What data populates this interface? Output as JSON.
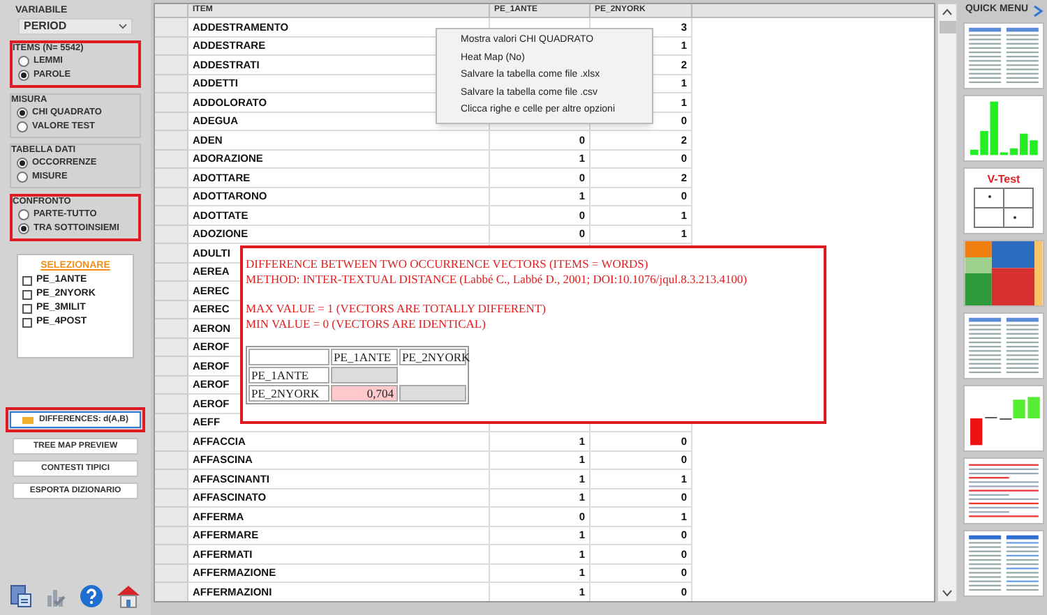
{
  "sidebar": {
    "variable": {
      "label": "VARIABILE",
      "value": "PERIOD"
    },
    "groups": [
      {
        "title": "ITEMS (N= 5542)",
        "highlighted": true,
        "options": [
          {
            "label": "LEMMI",
            "selected": false
          },
          {
            "label": "PAROLE",
            "selected": true
          }
        ]
      },
      {
        "title": "MISURA",
        "highlighted": false,
        "options": [
          {
            "label": "CHI QUADRATO",
            "selected": true
          },
          {
            "label": "VALORE TEST",
            "selected": false
          }
        ]
      },
      {
        "title": "TABELLA DATI",
        "highlighted": false,
        "options": [
          {
            "label": "OCCORRENZE",
            "selected": true
          },
          {
            "label": "MISURE",
            "selected": false
          }
        ]
      },
      {
        "title": "CONFRONTO",
        "highlighted": true,
        "options": [
          {
            "label": "PARTE-TUTTO",
            "selected": false
          },
          {
            "label": "TRA SOTTOINSIEMI",
            "selected": true
          }
        ]
      }
    ],
    "select_link": "SELEZIONARE",
    "subsets": [
      {
        "label": "PE_1ANTE",
        "checked": false
      },
      {
        "label": "PE_2NYORK",
        "checked": false
      },
      {
        "label": "PE_3MILIT",
        "checked": false
      },
      {
        "label": "PE_4POST",
        "checked": false
      }
    ],
    "buttons": [
      {
        "label": "DIFFERENCES: d(A,B)",
        "kind": "icon",
        "highlighted": true
      },
      {
        "label": "TREE MAP PREVIEW",
        "kind": "plain",
        "highlighted": false
      },
      {
        "label": "CONTESTI TIPICI",
        "kind": "plain",
        "highlighted": false
      },
      {
        "label": "ESPORTA DIZIONARIO",
        "kind": "plain",
        "highlighted": false
      }
    ],
    "tools": [
      {
        "kind": "export"
      },
      {
        "kind": "chart"
      },
      {
        "kind": "help"
      },
      {
        "kind": "home"
      }
    ]
  },
  "table": {
    "columns": [
      "ITEM",
      "PE_1ANTE",
      "PE_2NYORK"
    ],
    "rows": [
      {
        "item": "ADDESTRAMENTO",
        "pe_2nyork": "3"
      },
      {
        "item": "ADDESTRARE",
        "pe_2nyork": "1"
      },
      {
        "item": "ADDESTRATI",
        "pe_2nyork": "2"
      },
      {
        "item": "ADDETTI",
        "pe_2nyork": "1"
      },
      {
        "item": "ADDOLORATO",
        "pe_2nyork": "1"
      },
      {
        "item": "ADEGUA",
        "pe_2nyork": "0"
      },
      {
        "item": "ADEN",
        "pe_1ante": "0",
        "pe_2nyork": "2"
      },
      {
        "item": "ADORAZIONE",
        "pe_1ante": "1",
        "pe_2nyork": "0"
      },
      {
        "item": "ADOTTARE",
        "pe_1ante": "0",
        "pe_2nyork": "2"
      },
      {
        "item": "ADOTTARONO",
        "pe_1ante": "1",
        "pe_2nyork": "0"
      },
      {
        "item": "ADOTTATE",
        "pe_1ante": "0",
        "pe_2nyork": "1"
      },
      {
        "item": "ADOZIONE",
        "pe_1ante": "0",
        "pe_2nyork": "1"
      },
      {
        "item": "ADULTI"
      },
      {
        "item": "AEREA"
      },
      {
        "item": "AEREC"
      },
      {
        "item": "AEREC"
      },
      {
        "item": "AERON"
      },
      {
        "item": "AEROF"
      },
      {
        "item": "AEROF"
      },
      {
        "item": "AEROF"
      },
      {
        "item": "AEROF"
      },
      {
        "item": "AEFF"
      },
      {
        "item": "AFFACCIA",
        "pe_1ante": "1",
        "pe_2nyork": "0"
      },
      {
        "item": "AFFASCINA",
        "pe_1ante": "1",
        "pe_2nyork": "0"
      },
      {
        "item": "AFFASCINANTI",
        "pe_1ante": "1",
        "pe_2nyork": "1"
      },
      {
        "item": "AFFASCINATO",
        "pe_1ante": "1",
        "pe_2nyork": "0"
      },
      {
        "item": "AFFERMA",
        "pe_1ante": "0",
        "pe_2nyork": "1"
      },
      {
        "item": "AFFERMARE",
        "pe_1ante": "1",
        "pe_2nyork": "0"
      },
      {
        "item": "AFFERMATI",
        "pe_1ante": "1",
        "pe_2nyork": "0"
      },
      {
        "item": "AFFERMAZIONE",
        "pe_1ante": "1",
        "pe_2nyork": "0"
      },
      {
        "item": "AFFERMAZIONI",
        "pe_1ante": "1",
        "pe_2nyork": "0"
      }
    ]
  },
  "context_menu": {
    "items": [
      "Mostra valori CHI QUADRATO",
      "Heat Map (No)",
      "Salvare la tabella come file .xlsx",
      "Salvare la tabella come file .csv",
      "Clicca righe e celle per altre opzioni"
    ]
  },
  "popup": {
    "paragraphs": [
      [
        "DIFFERENCE BETWEEN TWO OCCURRENCE VECTORS (ITEMS = WORDS)",
        "METHOD: INTER-TEXTUAL DISTANCE (Labbé C., Labbé D., 2001; DOI:10.1076/jqul.8.3.213.4100)"
      ],
      [
        "MAX VALUE = 1 (VECTORS ARE TOTALLY DIFFERENT)",
        "MIN VALUE = 0 (VECTORS ARE IDENTICAL)"
      ]
    ],
    "matrix": {
      "columns": [
        "PE_1ANTE",
        "PE_2NYORK"
      ],
      "rows": [
        {
          "label": "PE_1ANTE",
          "cells": [
            {
              "kind": "diagonal"
            },
            {
              "kind": "empty"
            }
          ]
        },
        {
          "label": "PE_2NYORK",
          "cells": [
            {
              "kind": "value",
              "value": "0,704"
            },
            {
              "kind": "diagonal"
            }
          ]
        }
      ]
    }
  },
  "quick_menu": {
    "title": "QUICK MENU",
    "items": [
      {
        "kind": "table"
      },
      {
        "kind": "bars"
      },
      {
        "kind": "vtest",
        "label": "V-Test"
      },
      {
        "kind": "treemap"
      },
      {
        "kind": "table"
      },
      {
        "kind": "redbars"
      },
      {
        "kind": "text"
      },
      {
        "kind": "bluetable"
      }
    ]
  }
}
